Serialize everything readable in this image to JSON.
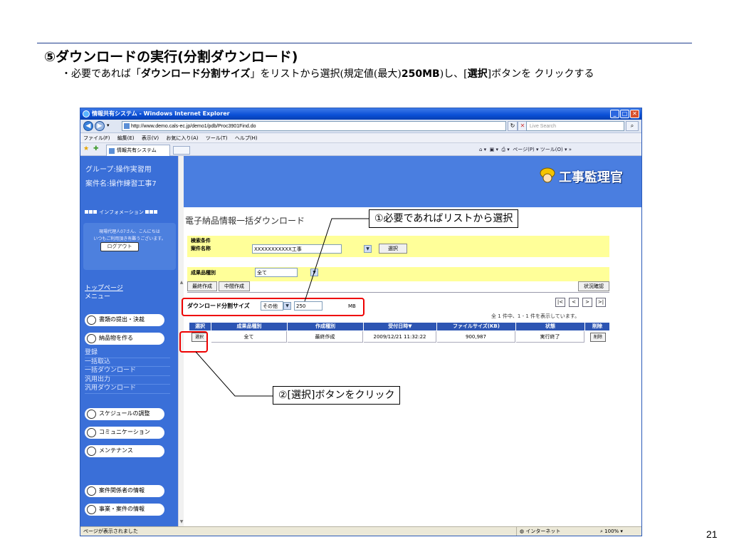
{
  "slide": {
    "title": "⑤ダウンロードの実行(分割ダウンロード)",
    "desc_pre": "・必要であれば「",
    "desc_b1": "ダウンロード分割サイズ",
    "desc_mid": "」をリストから選択(規定値(最大)",
    "desc_b2": "250MB",
    "desc_mid2": ")し、[",
    "desc_b3": "選択",
    "desc_post": "]ボタンを クリックする",
    "page_number": "21"
  },
  "browser": {
    "window_title": "情報共有システム - Windows Internet Explorer",
    "url": "http://www.demo.cals-ec.jp/demo1/pdb/Proc3901Find.do",
    "search_placeholder": "Live Search",
    "menu": [
      "ファイル(F)",
      "編集(E)",
      "表示(V)",
      "お気に入り(A)",
      "ツール(T)",
      "ヘルプ(H)"
    ],
    "tab_title": "情報共有システム",
    "command_bar": "ページ(P) ▾  ツール(O) ▾",
    "status_left": "ページが表示されました",
    "status_zone": "インターネット",
    "status_zoom": "100%"
  },
  "app": {
    "group": "グループ:操作実習用",
    "project": "案件名:操作練習工事7",
    "logo_text": "工事監理官",
    "info_header": "インフォメーション",
    "welcome_line1": "現場代理人07さん、こんにちは",
    "welcome_line2": "いつもご利用頂き有難うございます。",
    "logout": "ログアウト",
    "top_page": "トップページ",
    "menu_label": "メニュー",
    "nav": {
      "documents": "書類の提出・決裁",
      "deliverables": "納品物を作る",
      "schedule": "スケジュールの調整",
      "communication": "コミュニケーション",
      "maintenance": "メンテナンス",
      "stakeholders": "案件関係者の情報",
      "business": "事業・案件の情報"
    },
    "submenu": [
      "登録",
      "一括取込",
      "一括ダウンロード",
      "汎用出力",
      "汎用ダウンロード"
    ]
  },
  "content": {
    "title": "電子納品情報一括ダウンロード",
    "search_conditions": "検索条件",
    "project_name_label": "案件名称",
    "project_name_value": "XXXXXXXXXXX工事",
    "select_button": "選択",
    "product_type_label": "成果品種別",
    "product_type_value": "全て",
    "tab_final": "最終作成",
    "tab_interim": "中間作成",
    "status_check": "状況確認",
    "split_size_label": "ダウンロード分割サイズ",
    "split_option": "その他",
    "split_value": "250",
    "split_unit": "MB",
    "count_text": "全 1 件中、1 - 1 件を表示しています。",
    "pager": [
      "|<",
      "<",
      ">",
      ">|"
    ],
    "columns": [
      "選択",
      "成果品種別",
      "作成種別",
      "受付日時▼",
      "ファイルサイズ(KB)",
      "状態",
      "削除"
    ],
    "row": {
      "select_btn": "選択",
      "product_type": "全て",
      "creation_type": "最終作成",
      "received": "2009/12/21 11:32:22",
      "file_size": "900,987",
      "status": "実行終了",
      "delete_btn": "削除"
    }
  },
  "callouts": {
    "c1": "①必要であればリストから選択",
    "c2": "②[選択]ボタンをクリック"
  },
  "colors": {
    "sidebar": "#3a6fd8",
    "panel": "#ffff99",
    "table_header": "#2d55b3",
    "highlight": "#e00000"
  }
}
